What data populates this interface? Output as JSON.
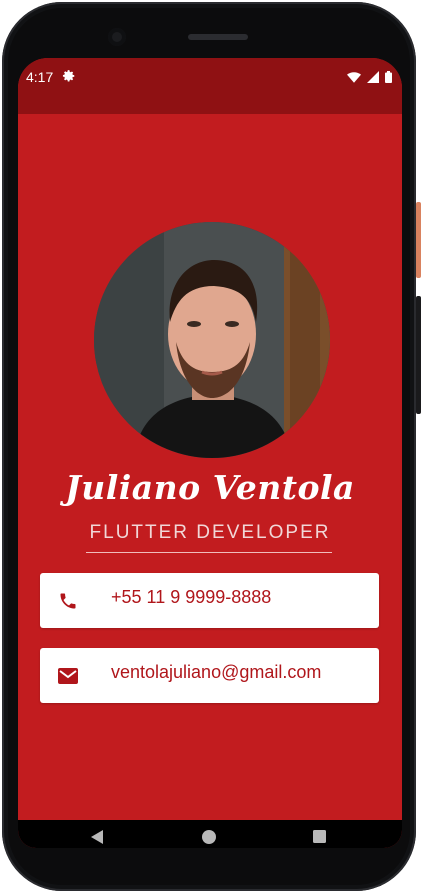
{
  "status_bar": {
    "time": "4:17",
    "icons": [
      "settings-gear-icon",
      "wifi-icon",
      "cell-signal-icon",
      "battery-icon"
    ]
  },
  "profile": {
    "name": "Juliano Ventola",
    "title": "FLUTTER DEVELOPER",
    "avatar": "profile-photo"
  },
  "contacts": [
    {
      "type": "phone",
      "icon": "phone-icon",
      "value": "+55 11 9 9999-8888"
    },
    {
      "type": "email",
      "icon": "mail-icon",
      "value": "ventolajuliano@gmail.com"
    }
  ],
  "nav_bar": {
    "buttons": [
      "back-icon",
      "home-icon",
      "recents-icon"
    ]
  },
  "colors": {
    "background": "#c21c1f",
    "status_bar": "#8f1113",
    "card": "#ffffff",
    "accent_text": "#b0161b"
  }
}
